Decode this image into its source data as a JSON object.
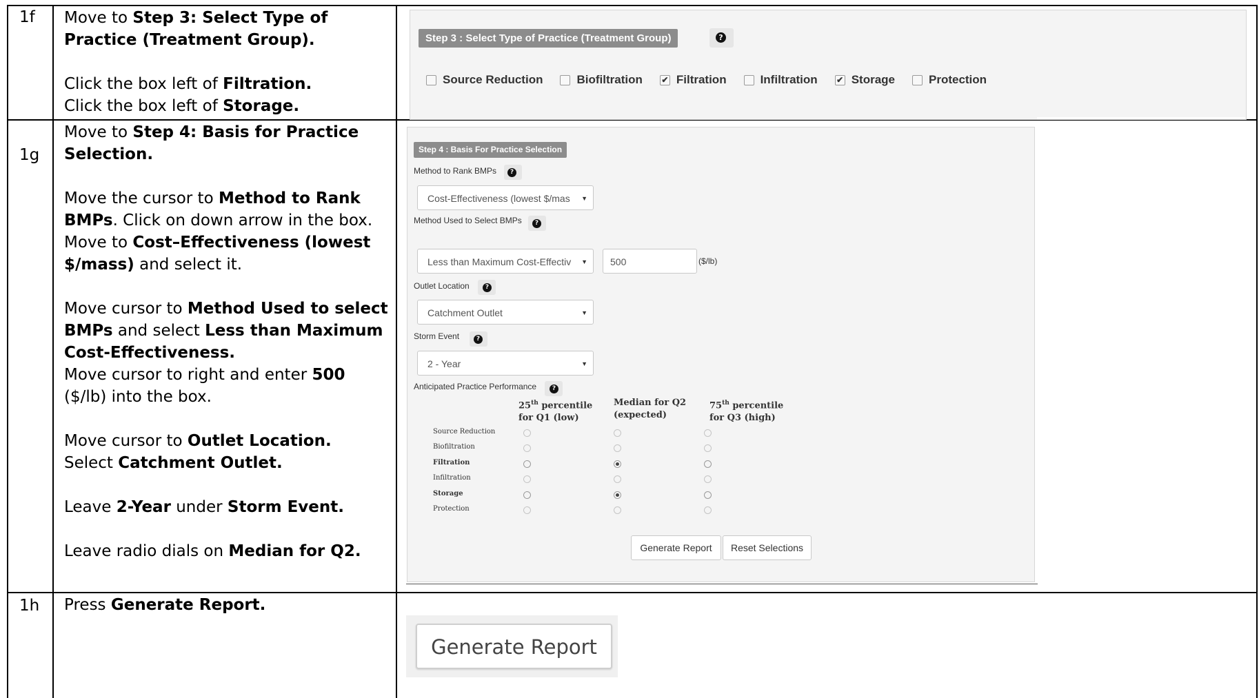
{
  "rows": [
    {
      "step": "1f",
      "paragraphs": [
        [
          {
            "t": "Move to "
          },
          {
            "t": "Step 3: Select Type of Practice (Treatment Group).",
            "b": true
          }
        ],
        null,
        [
          {
            "t": "Click the box left of "
          },
          {
            "t": "Filtration.",
            "b": true
          }
        ],
        [
          {
            "t": "Click the box left of "
          },
          {
            "t": "Storage.",
            "b": true
          }
        ]
      ]
    },
    {
      "step": "1g",
      "paragraphs": [
        [
          {
            "t": "Move to "
          },
          {
            "t": "Step 4: Basis for Practice Selection.",
            "b": true
          }
        ],
        null,
        [
          {
            "t": "Move the cursor to "
          },
          {
            "t": "Method to Rank BMPs",
            "b": true
          },
          {
            "t": ". Click on down arrow in the box. Move to "
          },
          {
            "t": "Cost–Effectiveness (lowest $/mass)",
            "b": true
          },
          {
            "t": " and select it."
          }
        ],
        null,
        [
          {
            "t": "Move cursor to "
          },
          {
            "t": "Method Used to select BMPs",
            "b": true
          },
          {
            "t": " and select "
          },
          {
            "t": "Less than Maximum Cost-Effectiveness.",
            "b": true
          }
        ],
        [
          {
            "t": "Move cursor to right and enter "
          },
          {
            "t": "500",
            "b": true
          },
          {
            "t": " ($/lb) into the box."
          }
        ],
        null,
        [
          {
            "t": "Move cursor to "
          },
          {
            "t": "Outlet Location.",
            "b": true
          }
        ],
        [
          {
            "t": "Select "
          },
          {
            "t": "Catchment Outlet.",
            "b": true
          }
        ],
        null,
        [
          {
            "t": "Leave "
          },
          {
            "t": "2-Year",
            "b": true
          },
          {
            "t": " under "
          },
          {
            "t": "Storm Event.",
            "b": true
          }
        ],
        null,
        [
          {
            "t": "Leave radio dials on "
          },
          {
            "t": "Median for Q2.",
            "b": true
          }
        ]
      ]
    },
    {
      "step": "1h",
      "paragraphs": [
        [
          {
            "t": "Press "
          },
          {
            "t": "Generate Report.",
            "b": true
          }
        ]
      ]
    }
  ],
  "step3": {
    "header": "Step 3 : Select Type of Practice (Treatment Group)",
    "help": "?",
    "checkboxes": [
      {
        "label": "Source Reduction",
        "checked": false
      },
      {
        "label": "Biofiltration",
        "checked": false
      },
      {
        "label": "Filtration",
        "checked": true
      },
      {
        "label": "Infiltration",
        "checked": false
      },
      {
        "label": "Storage",
        "checked": true
      },
      {
        "label": "Protection",
        "checked": false
      }
    ]
  },
  "step4": {
    "header": "Step 4 : Basis For Practice Selection",
    "help": "?",
    "method_rank_label": "Method to Rank BMPs",
    "method_rank_value": "Cost-Effectiveness (lowest $/mas",
    "method_select_label": "Method Used to Select BMPs",
    "method_select_value": "Less than Maximum Cost-Effectiv",
    "max_value": "500",
    "max_unit": "($/lb)",
    "outlet_label": "Outlet Location",
    "outlet_value": "Catchment Outlet",
    "storm_label": "Storm Event",
    "storm_value": "2 - Year",
    "perf_label": "Anticipated Practice Performance",
    "col_q1_a": "25",
    "col_q1_sup": "th",
    "col_q1_b": " percentile",
    "col_q1_c": "for Q1 (low)",
    "col_q2_a": "Median for Q2",
    "col_q2_b": "(expected)",
    "col_q3_a": "75",
    "col_q3_sup": "th",
    "col_q3_b": " percentile",
    "col_q3_c": "for Q3 (high)",
    "practices": [
      {
        "name": "Source Reduction",
        "bold": false,
        "selected": "Median for Q2",
        "enabled": false
      },
      {
        "name": "Biofiltration",
        "bold": false,
        "selected": "Median for Q2",
        "enabled": false
      },
      {
        "name": "Filtration",
        "bold": true,
        "selected": "Median for Q2",
        "enabled": true
      },
      {
        "name": "Infiltration",
        "bold": false,
        "selected": "Median for Q2",
        "enabled": false
      },
      {
        "name": "Storage",
        "bold": true,
        "selected": "Median for Q2",
        "enabled": true
      },
      {
        "name": "Protection",
        "bold": false,
        "selected": "Median for Q2",
        "enabled": false
      }
    ],
    "generate_label": "Generate Report",
    "reset_label": "Reset Selections"
  },
  "step5": {
    "generate_label": "Generate Report"
  }
}
